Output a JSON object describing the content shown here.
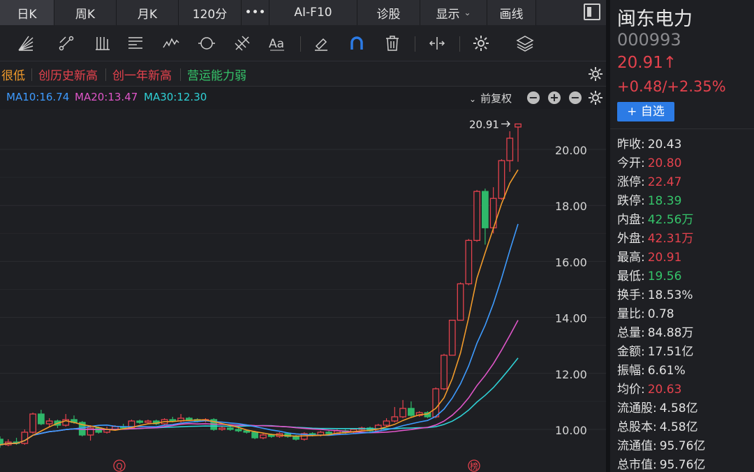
{
  "tabs": [
    {
      "label": "日K",
      "active": true
    },
    {
      "label": "周K",
      "active": false
    },
    {
      "label": "月K",
      "active": false
    },
    {
      "label": "120分",
      "active": false
    },
    {
      "label": "•••",
      "active": false
    },
    {
      "label": "AI-F10",
      "active": false
    },
    {
      "label": "诊股",
      "active": false
    },
    {
      "label": "显示",
      "active": false,
      "has_arrow": true
    },
    {
      "label": "画线",
      "active": false
    }
  ],
  "toolbar_icons": [
    "fan-lines-icon",
    "segment-icon",
    "parallel-lines-icon",
    "text-lines-icon",
    "wave-icon",
    "circle-icon",
    "fib-icon",
    "text-style-icon",
    "eraser-icon",
    "magnet-icon",
    "trash-icon",
    "crosshair-icon",
    "settings-icon",
    "layers-icon"
  ],
  "badges": [
    {
      "text": "很低",
      "color": "#f29b2b"
    },
    {
      "text": "创历史新高",
      "color": "#e5424d"
    },
    {
      "text": "创一年新高",
      "color": "#e5424d"
    },
    {
      "text": "营运能力弱",
      "color": "#35c46a"
    }
  ],
  "ma_labels": [
    {
      "text": "MA10:16.74",
      "color": "#3e9bff"
    },
    {
      "text": "MA20:13.47",
      "color": "#e056c9"
    },
    {
      "text": "MA30:12.30",
      "color": "#2fd1d6"
    }
  ],
  "fq_label": "前复权",
  "chart_data": {
    "type": "candlestick",
    "y_ticks": [
      "20.00",
      "18.00",
      "16.00",
      "14.00",
      "12.00",
      "10.00"
    ],
    "ylim": [
      9.3,
      21.1
    ],
    "last_price_label": "20.91",
    "markers": [
      "Q",
      "榜"
    ],
    "candles": [
      [
        9.65,
        9.45,
        9.75,
        9.35
      ],
      [
        9.45,
        9.55,
        9.65,
        9.4
      ],
      [
        9.55,
        9.5,
        9.7,
        9.45
      ],
      [
        9.5,
        9.9,
        10.0,
        9.45
      ],
      [
        9.9,
        10.55,
        10.6,
        9.85
      ],
      [
        10.55,
        10.2,
        10.7,
        10.15
      ],
      [
        10.2,
        10.3,
        10.4,
        10.1
      ],
      [
        10.3,
        10.15,
        10.35,
        10.05
      ],
      [
        10.15,
        10.35,
        10.55,
        10.1
      ],
      [
        10.35,
        10.25,
        10.5,
        10.2
      ],
      [
        10.25,
        9.8,
        10.3,
        9.75
      ],
      [
        9.8,
        10.05,
        10.15,
        9.6
      ],
      [
        10.05,
        9.9,
        10.1,
        9.85
      ],
      [
        9.9,
        10.0,
        10.1,
        9.85
      ],
      [
        10.0,
        10.1,
        10.15,
        9.95
      ],
      [
        10.1,
        10.05,
        10.2,
        10.0
      ],
      [
        10.05,
        10.3,
        10.35,
        10.0
      ],
      [
        10.3,
        10.25,
        10.35,
        10.2
      ],
      [
        10.25,
        10.3,
        10.35,
        10.2
      ],
      [
        10.3,
        10.2,
        10.35,
        10.15
      ],
      [
        10.2,
        10.35,
        10.4,
        10.15
      ],
      [
        10.35,
        10.3,
        10.45,
        10.25
      ],
      [
        10.3,
        10.4,
        10.55,
        10.25
      ],
      [
        10.4,
        10.35,
        10.45,
        10.3
      ],
      [
        10.35,
        10.3,
        10.4,
        10.25
      ],
      [
        10.3,
        10.35,
        10.4,
        10.25
      ],
      [
        10.35,
        10.0,
        10.4,
        9.95
      ],
      [
        10.0,
        10.05,
        10.1,
        9.95
      ],
      [
        10.05,
        10.0,
        10.1,
        9.95
      ],
      [
        10.0,
        9.95,
        10.05,
        9.9
      ],
      [
        9.95,
        9.9,
        10.0,
        9.85
      ],
      [
        9.9,
        9.7,
        9.95,
        9.65
      ],
      [
        9.7,
        9.8,
        9.85,
        9.65
      ],
      [
        9.8,
        9.75,
        9.85,
        9.7
      ],
      [
        9.75,
        9.85,
        9.9,
        9.7
      ],
      [
        9.85,
        9.75,
        9.9,
        9.7
      ],
      [
        9.75,
        9.65,
        9.8,
        9.6
      ],
      [
        9.65,
        9.85,
        9.9,
        9.6
      ],
      [
        9.85,
        9.8,
        9.9,
        9.75
      ],
      [
        9.8,
        9.9,
        9.95,
        9.75
      ],
      [
        9.9,
        9.85,
        9.95,
        9.8
      ],
      [
        9.85,
        9.95,
        10.0,
        9.8
      ],
      [
        9.95,
        9.9,
        10.0,
        9.85
      ],
      [
        9.9,
        10.0,
        10.05,
        9.85
      ],
      [
        10.0,
        10.05,
        10.1,
        9.95
      ],
      [
        10.05,
        9.95,
        10.1,
        9.9
      ],
      [
        9.95,
        10.15,
        10.2,
        9.9
      ],
      [
        10.15,
        10.3,
        10.4,
        10.1
      ],
      [
        10.3,
        10.45,
        10.8,
        10.25
      ],
      [
        10.45,
        10.75,
        11.05,
        10.4
      ],
      [
        10.75,
        10.5,
        11.0,
        10.45
      ],
      [
        10.5,
        10.6,
        10.65,
        10.45
      ],
      [
        10.6,
        10.45,
        10.65,
        10.4
      ],
      [
        10.45,
        11.45,
        11.5,
        10.4
      ],
      [
        11.45,
        12.65,
        12.7,
        11.4
      ],
      [
        12.65,
        13.9,
        13.9,
        13.5
      ],
      [
        13.9,
        15.2,
        15.25,
        13.9
      ],
      [
        15.2,
        16.75,
        16.8,
        15.15
      ],
      [
        16.75,
        18.5,
        18.55,
        16.7
      ],
      [
        18.5,
        17.2,
        18.6,
        16.6
      ],
      [
        17.2,
        18.25,
        18.65,
        17.0
      ],
      [
        18.25,
        19.6,
        19.65,
        18.2
      ],
      [
        19.6,
        20.4,
        20.65,
        19.2
      ],
      [
        20.8,
        20.91,
        20.91,
        19.56
      ]
    ],
    "ma_colors": {
      "ma5": "#f29b2b",
      "ma10": "#3e9bff",
      "ma20": "#e056c9",
      "ma30": "#2fd1d6"
    }
  },
  "stock": {
    "name": "闽东电力",
    "code": "000993",
    "price": "20.91↑",
    "change": "+0.48/+2.35%",
    "watch_label": "+ 自选"
  },
  "stats": [
    {
      "label": "昨收:",
      "value": "20.43",
      "color": ""
    },
    {
      "label": "今开:",
      "value": "20.80",
      "color": "red"
    },
    {
      "label": "涨停:",
      "value": "22.47",
      "color": "red"
    },
    {
      "label": "跌停:",
      "value": "18.39",
      "color": "green"
    },
    {
      "label": "内盘:",
      "value": "42.56万",
      "color": "green"
    },
    {
      "label": "外盘:",
      "value": "42.31万",
      "color": "red"
    },
    {
      "label": "最高:",
      "value": "20.91",
      "color": "red"
    },
    {
      "label": "最低:",
      "value": "19.56",
      "color": "green"
    },
    {
      "label": "换手:",
      "value": "18.53%",
      "color": ""
    },
    {
      "label": "量比:",
      "value": "0.78",
      "color": ""
    },
    {
      "label": "总量:",
      "value": "84.88万",
      "color": ""
    },
    {
      "label": "金额:",
      "value": "17.51亿",
      "color": ""
    },
    {
      "label": "振幅:",
      "value": "6.61%",
      "color": ""
    },
    {
      "label": "均价:",
      "value": "20.63",
      "color": "red"
    },
    {
      "label": "流通股:",
      "value": "4.58亿",
      "color": ""
    },
    {
      "label": "总股本:",
      "value": "4.58亿",
      "color": ""
    },
    {
      "label": "流通值:",
      "value": "95.76亿",
      "color": ""
    },
    {
      "label": "总市值:",
      "value": "95.76亿",
      "color": ""
    }
  ]
}
